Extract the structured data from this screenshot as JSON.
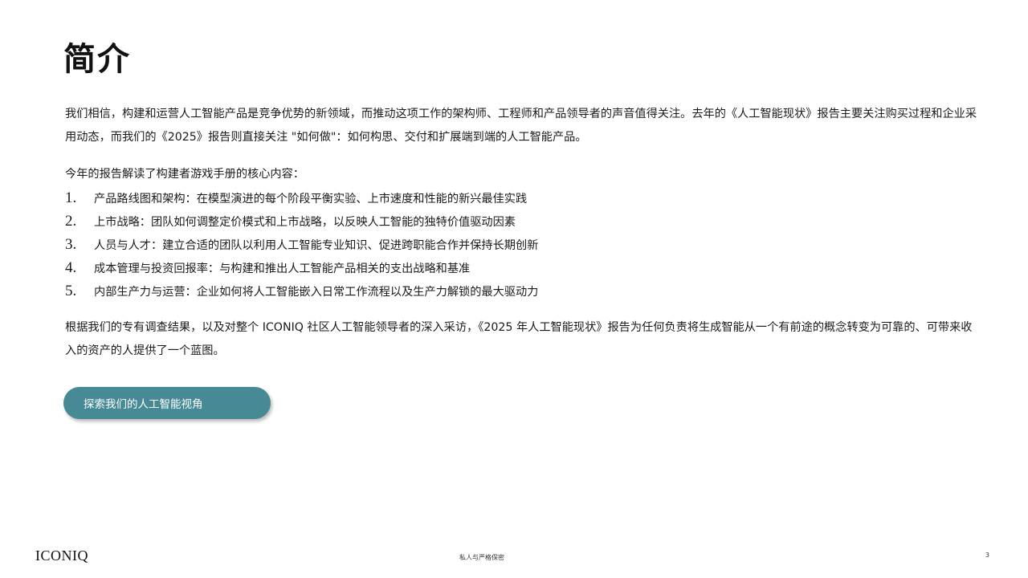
{
  "title": "简介",
  "intro": {
    "paragraph1": "我们相信，构建和运营人工智能产品是竞争优势的新领域，而推动这项工作的架构师、工程师和产品领导者的声音值得关注。去年的《人工智能现状》报告主要关注购买过程和企业采用动态，而我们的《2025》报告则直接关注 \"如何做\"：如何构思、交付和扩展端到端的人工智能产品。",
    "list_heading": "今年的报告解读了构建者游戏手册的核心内容：",
    "items": [
      {
        "number": "1.",
        "text": "产品路线图和架构：在模型演进的每个阶段平衡实验、上市速度和性能的新兴最佳实践"
      },
      {
        "number": "2.",
        "text": "上市战略：团队如何调整定价模式和上市战略，以反映人工智能的独特价值驱动因素"
      },
      {
        "number": "3.",
        "text": "人员与人才：建立合适的团队以利用人工智能专业知识、促进跨职能合作并保持长期创新"
      },
      {
        "number": "4.",
        "text": "成本管理与投资回报率：与构建和推出人工智能产品相关的支出战略和基准"
      },
      {
        "number": "5.",
        "text": "内部生产力与运营：企业如何将人工智能嵌入日常工作流程以及生产力解锁的最大驱动力"
      }
    ],
    "paragraph2": "根据我们的专有调查结果，以及对整个 ICONIQ 社区人工智能领导者的深入采访，《2025 年人工智能现状》报告为任何负责将生成智能从一个有前途的概念转变为可靠的、可带来收入的资产的人提供了一个蓝图。"
  },
  "cta": {
    "label": "探索我们的人工智能视角",
    "color": "#468a96"
  },
  "footer": {
    "logo": "ICONIQ",
    "confidential": "私人与严格保密",
    "page_number": "3"
  }
}
